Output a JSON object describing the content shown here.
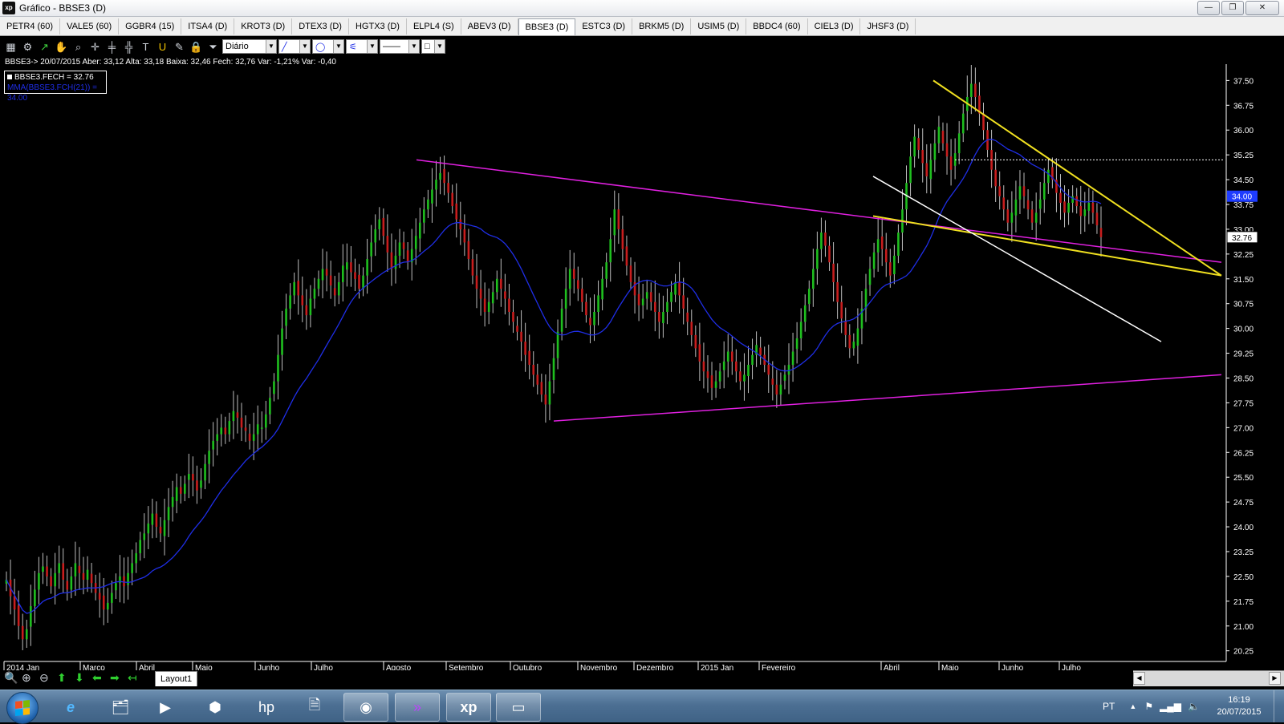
{
  "window": {
    "title": "Gráfico - BBSE3 (D)",
    "app_icon_text": "xp",
    "minimize": "—",
    "restore": "❐",
    "close": "✕"
  },
  "tabs": [
    "PETR4 (60)",
    "VALE5 (60)",
    "GGBR4 (15)",
    "ITSA4 (D)",
    "KROT3 (D)",
    "DTEX3 (D)",
    "HGTX3 (D)",
    "ELPL4 (S)",
    "ABEV3 (D)",
    "BBSE3 (D)",
    "ESTC3 (D)",
    "BRKM5 (D)",
    "USIM5 (D)",
    "BBDC4 (60)",
    "CIEL3 (D)",
    "JHSF3 (D)"
  ],
  "active_tab": "BBSE3 (D)",
  "toolbar": {
    "icons": [
      "chart-type-icon",
      "settings-icon",
      "cursor-icon",
      "hand-icon",
      "magnifier-icon",
      "crosshair-icon",
      "hline-icon",
      "grid-icon",
      "text-icon",
      "magnet-icon",
      "eraser-icon",
      "lock-icon",
      "filter-icon"
    ],
    "period_select": "Diário",
    "line_tool_glyph": "╱",
    "ellipse_tool_glyph": "◯",
    "fib_tool_glyph": "⚟",
    "line_style_glyph": "——",
    "color_box_glyph": "□"
  },
  "info_line": "BBSE3-> 20/07/2015 Aber: 33,12 Alta: 33,18 Baixa: 32,46 Fech: 32,76 Var: -1,21% Var: -0,40",
  "legend": {
    "fech": "BBSE3.FECH = 32.76",
    "mma": "MMA(BBSE3.FCH(21)) = 34.00"
  },
  "colors": {
    "background": "#000000",
    "up_candle": "#1fbf1f",
    "down_candle": "#c81e1e",
    "wick": "#bdbdbd",
    "mma": "#1f2ee6",
    "magenta_line": "#e020e0",
    "yellow_line": "#f0e020",
    "white_line": "#ffffff",
    "price_tag": "#1e3cff"
  },
  "chart_data": {
    "type": "candlestick",
    "title": "",
    "symbol": "BBSE3",
    "period": "Diário",
    "x_labels": [
      "2014 Jan",
      "Março",
      "Abril",
      "Maio",
      "Junho",
      "Julho",
      "Agosto",
      "Setembro",
      "Outubro",
      "Novembro",
      "Dezembro",
      "2015 Jan",
      "Fevereiro",
      "Abril",
      "Maio",
      "Junho",
      "Julho"
    ],
    "y_ticks": [
      "37.50",
      "36.75",
      "36.00",
      "35.25",
      "34.50",
      "33.75",
      "33.00",
      "32.25",
      "31.50",
      "30.75",
      "30.00",
      "29.25",
      "28.50",
      "27.75",
      "27.00",
      "26.25",
      "25.50",
      "24.75",
      "24.00",
      "23.25",
      "22.50",
      "21.75",
      "21.00",
      "20.25"
    ],
    "ylim": [
      20.0,
      37.8
    ],
    "last_close": 32.76,
    "last_close_label": "32.76",
    "mma_label": "34.00",
    "mma_period": 21,
    "closes": [
      22.4,
      21.9,
      21.5,
      21.0,
      20.6,
      20.9,
      21.6,
      22.1,
      22.6,
      22.8,
      22.5,
      22.2,
      22.6,
      22.9,
      22.4,
      22.1,
      22.5,
      22.9,
      22.6,
      22.4,
      22.7,
      22.3,
      22.0,
      21.8,
      21.5,
      21.7,
      22.0,
      22.3,
      22.5,
      22.2,
      22.6,
      22.9,
      23.2,
      23.6,
      23.8,
      24.1,
      24.4,
      24.0,
      23.8,
      24.2,
      24.6,
      24.9,
      25.2,
      25.0,
      25.3,
      25.6,
      25.4,
      25.1,
      25.4,
      25.9,
      26.3,
      26.6,
      26.8,
      27.0,
      26.8,
      27.2,
      27.5,
      27.3,
      27.0,
      26.9,
      26.6,
      26.8,
      27.1,
      27.0,
      27.4,
      27.9,
      28.4,
      29.2,
      30.0,
      30.6,
      31.0,
      31.4,
      31.0,
      30.7,
      30.4,
      30.9,
      31.2,
      31.5,
      31.8,
      31.6,
      31.3,
      31.0,
      31.4,
      31.9,
      32.0,
      31.7,
      31.5,
      31.2,
      31.6,
      32.1,
      32.6,
      33.0,
      33.3,
      32.8,
      32.3,
      31.8,
      32.2,
      32.6,
      32.4,
      32.0,
      32.4,
      32.8,
      33.2,
      33.6,
      33.9,
      34.2,
      34.5,
      34.7,
      34.4,
      34.1,
      33.7,
      33.3,
      33.0,
      32.6,
      32.1,
      31.6,
      31.2,
      30.9,
      30.5,
      30.8,
      31.1,
      31.5,
      31.2,
      30.9,
      30.5,
      30.2,
      29.9,
      29.6,
      29.2,
      28.9,
      28.6,
      28.3,
      28.0,
      27.7,
      28.4,
      29.1,
      29.9,
      30.6,
      31.2,
      31.8,
      31.5,
      31.2,
      30.8,
      30.4,
      30.1,
      30.5,
      31.0,
      31.5,
      32.0,
      32.7,
      33.6,
      33.0,
      32.4,
      31.9,
      31.4,
      31.0,
      30.7,
      30.9,
      31.1,
      30.8,
      30.5,
      30.2,
      30.5,
      30.8,
      31.1,
      31.4,
      31.0,
      30.6,
      30.2,
      29.8,
      29.4,
      29.0,
      28.7,
      28.5,
      28.2,
      28.4,
      28.7,
      29.0,
      29.3,
      29.0,
      28.7,
      28.4,
      28.6,
      28.9,
      29.2,
      29.5,
      29.2,
      28.9,
      28.6,
      28.3,
      28.0,
      28.3,
      28.6,
      28.9,
      29.3,
      29.7,
      30.2,
      30.7,
      31.2,
      31.8,
      32.4,
      32.9,
      32.5,
      32.0,
      31.4,
      30.8,
      30.3,
      29.8,
      29.4,
      29.6,
      30.0,
      30.6,
      31.2,
      31.8,
      32.3,
      32.7,
      32.4,
      32.0,
      31.6,
      32.2,
      32.9,
      33.6,
      34.4,
      35.2,
      35.8,
      35.4,
      35.0,
      34.6,
      35.1,
      35.6,
      36.1,
      35.6,
      35.2,
      34.8,
      35.3,
      35.9,
      36.5,
      37.0,
      37.4,
      37.0,
      36.5,
      36.0,
      35.4,
      34.8,
      34.3,
      34.0,
      33.6,
      33.2,
      33.5,
      33.9,
      34.3,
      34.0,
      33.6,
      33.2,
      33.5,
      33.9,
      34.4,
      34.8,
      34.5,
      34.1,
      33.8,
      33.5,
      33.8,
      34.0,
      33.7,
      33.4,
      33.6,
      33.8,
      33.5,
      33.12,
      32.76
    ],
    "trendlines": [
      {
        "color": "magenta",
        "from": [
          "2014 Ago",
          35.1
        ],
        "to": [
          "2015 Ago",
          32.0
        ]
      },
      {
        "color": "magenta",
        "from": [
          "2014 Out",
          27.2
        ],
        "to": [
          "2015 Ago",
          28.6
        ]
      },
      {
        "color": "yellow",
        "from": [
          "2015 Mai",
          37.5
        ],
        "to": [
          "2015 Ago",
          31.6
        ]
      },
      {
        "color": "yellow",
        "from": [
          "2015 Abr",
          33.4
        ],
        "to": [
          "2015 Ago",
          31.6
        ]
      },
      {
        "color": "white",
        "from": [
          "2015 Abr",
          34.6
        ],
        "to": [
          "2015 Jul",
          29.6
        ]
      }
    ],
    "dashed_level": 35.1,
    "grid": false
  },
  "bottom": {
    "layout_tab": "Layout1",
    "nav_icons": [
      "zoom-icon",
      "zoom-in-icon",
      "zoom-out-icon",
      "up-arrow-icon",
      "down-arrow-icon",
      "left-arrow-icon",
      "right-arrow-icon",
      "back-arrow-icon"
    ]
  },
  "taskbar": {
    "items": [
      "ie-icon",
      "explorer-icon",
      "media-player-icon",
      "network-icon",
      "hp-icon",
      "files-icon",
      "chrome-icon",
      "app-arrow-icon",
      "xp-icon",
      "image-viewer-icon"
    ],
    "lang": "PT",
    "time": "16:19",
    "date": "20/07/2015"
  }
}
